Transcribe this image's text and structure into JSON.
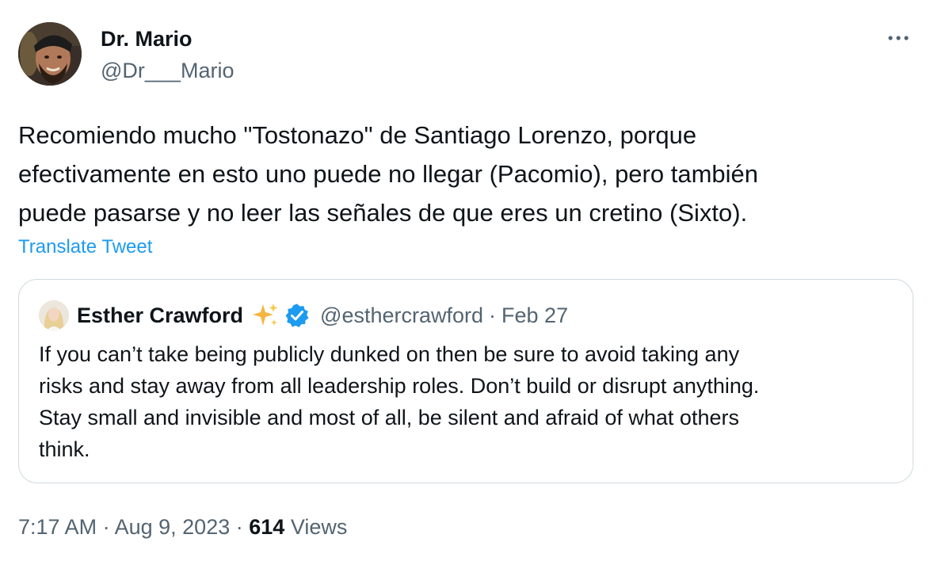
{
  "author": {
    "name": "Dr. Mario",
    "handle": "@Dr___Mario"
  },
  "tweet": {
    "lines": [
      "Recomiendo mucho \"Tostonazo\" de Santiago Lorenzo, porque",
      "efectivamente en esto uno puede no llegar (Pacomio), pero también",
      "puede pasarse y no leer las señales de que eres un cretino (Sixto)."
    ],
    "translate_label": "Translate Tweet"
  },
  "quote": {
    "name": "Esther Crawford",
    "handle": "@esthercrawford",
    "separator": "·",
    "date": "Feb 27",
    "lines": [
      "If you can’t take being publicly dunked on then be sure to avoid taking any",
      "risks and stay away from all leadership roles. Don’t build or disrupt anything.",
      "Stay small and invisible and most of all, be silent and afraid of what others",
      "think."
    ]
  },
  "meta": {
    "time": "7:17 AM",
    "sep1": "·",
    "date": "Aug 9, 2023",
    "sep2": "·",
    "views_count": "614",
    "views_label": "Views"
  },
  "colors": {
    "text": "#0f1419",
    "secondary": "#536471",
    "link": "#1d9bf0",
    "border": "#cfd9de",
    "verified": "#1d9bf0"
  },
  "icons": {
    "more": "more-horizontal-icon",
    "sparkle": "sparkles-icon",
    "verified": "verified-badge-icon"
  }
}
